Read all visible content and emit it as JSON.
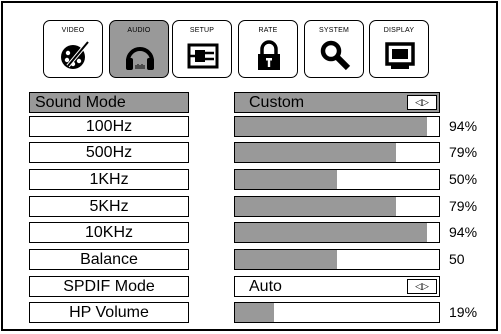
{
  "tabs": [
    {
      "label": "VIDEO",
      "icon": "video-disc-icon",
      "active": false
    },
    {
      "label": "AUDIO",
      "icon": "headphones-icon",
      "active": true
    },
    {
      "label": "SETUP",
      "icon": "setup-plug-icon",
      "active": false
    },
    {
      "label": "RATE",
      "icon": "padlock-icon",
      "active": false
    },
    {
      "label": "SYSTEM",
      "icon": "magnifier-icon",
      "active": false
    },
    {
      "label": "DISPLAY",
      "icon": "monitor-icon",
      "active": false
    }
  ],
  "sound_mode": {
    "label": "Sound Mode",
    "value": "Custom",
    "arrows": "◁▷"
  },
  "eq": [
    {
      "label": "100Hz",
      "level": 94,
      "text": "94%"
    },
    {
      "label": "500Hz",
      "level": 79,
      "text": "79%"
    },
    {
      "label": "1KHz",
      "level": 50,
      "text": "50%"
    },
    {
      "label": "5KHz",
      "level": 79,
      "text": "79%"
    },
    {
      "label": "10KHz",
      "level": 94,
      "text": "94%"
    }
  ],
  "balance": {
    "label": "Balance",
    "level": 50,
    "text": "50"
  },
  "spdif": {
    "label": "SPDIF Mode",
    "value": "Auto",
    "arrows": "◁▷"
  },
  "hp_volume": {
    "label": "HP Volume",
    "level": 19,
    "text": "19%"
  },
  "colors": {
    "active": "#999999",
    "border": "#000000",
    "background": "#ffffff"
  }
}
